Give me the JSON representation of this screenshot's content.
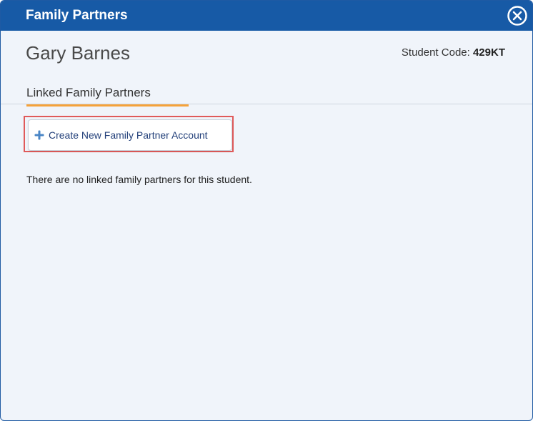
{
  "dialog": {
    "title": "Family Partners"
  },
  "student": {
    "name": "Gary Barnes",
    "code_label": "Student Code:",
    "code_value": "429KT"
  },
  "tabs": [
    {
      "label": "Linked Family Partners",
      "active": true
    }
  ],
  "actions": {
    "create_label": "Create New Family Partner Account"
  },
  "empty_message": "There are no linked family partners for this student.",
  "colors": {
    "titlebar": "#175aa6",
    "tab_underline": "#f5a23a",
    "highlight_border": "#e05a5a",
    "plus_icon": "#4a86c6"
  },
  "icons": {
    "close": "close-circle-icon",
    "create": "plus-icon"
  }
}
